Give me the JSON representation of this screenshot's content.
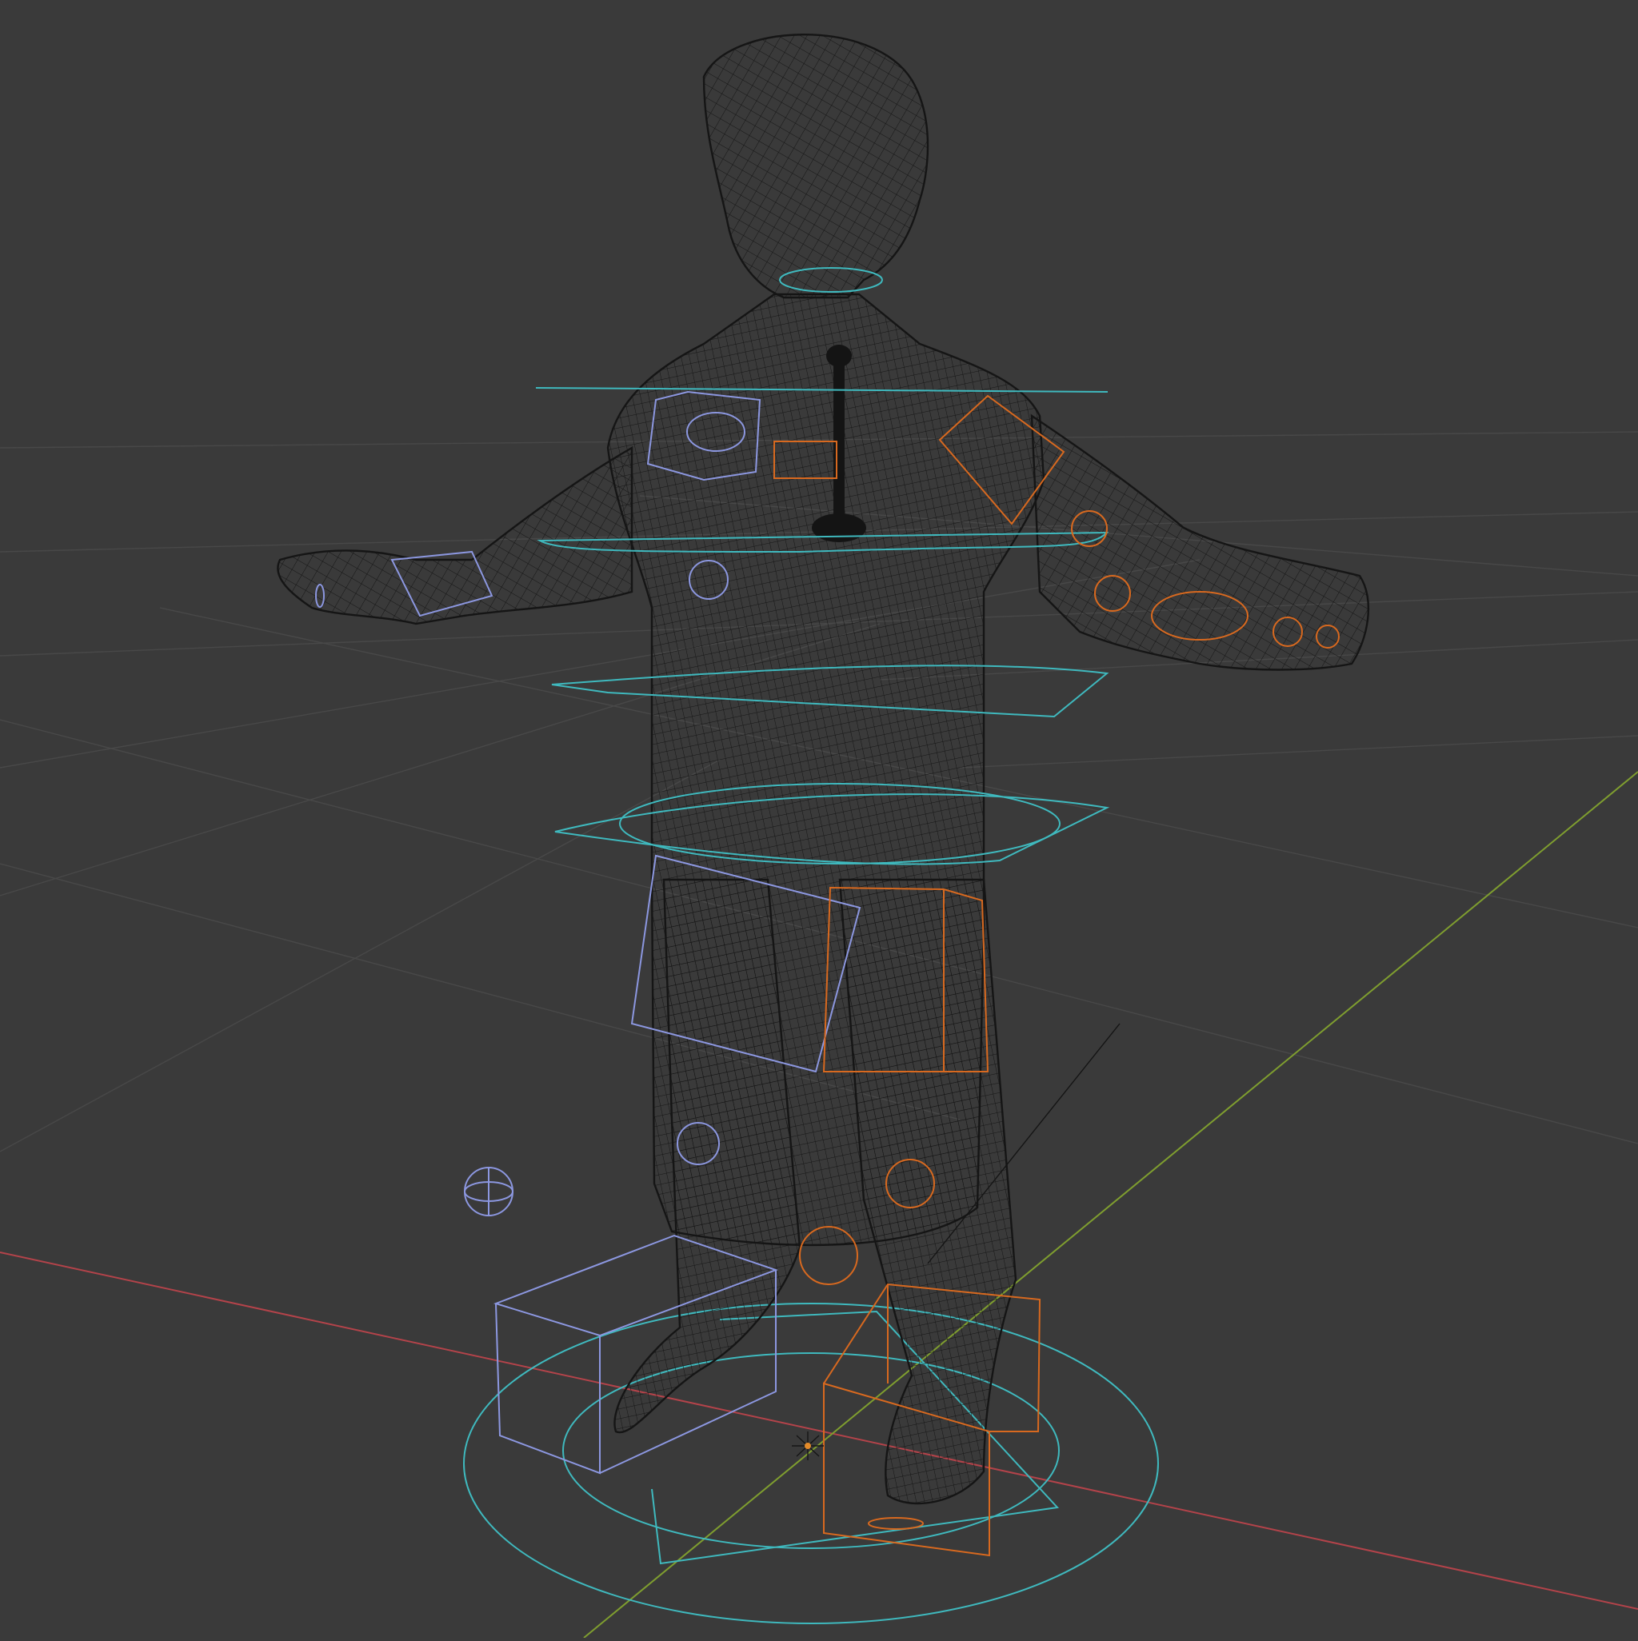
{
  "viewport": {
    "mode": "wireframe",
    "shading": "wireframe"
  },
  "scene": {
    "character": "character-mesh",
    "controls": {
      "neutral": [
        "root-circle",
        "torso-rings"
      ],
      "left_side": [
        "left-arm-controls",
        "left-leg-controls"
      ],
      "right_side": [
        "right-arm-controls",
        "right-leg-controls"
      ]
    }
  },
  "colors": {
    "background": "#3a3a3a",
    "grid": "#4a4a4a",
    "axis_x": "#b3434a",
    "axis_y": "#7f9e2f",
    "wire": "#151515",
    "ctrl_neutral": "#3fb9be",
    "ctrl_left": "#8c97e0",
    "ctrl_right": "#d8691f"
  },
  "icons": {
    "origin": "origin-marker-icon"
  }
}
